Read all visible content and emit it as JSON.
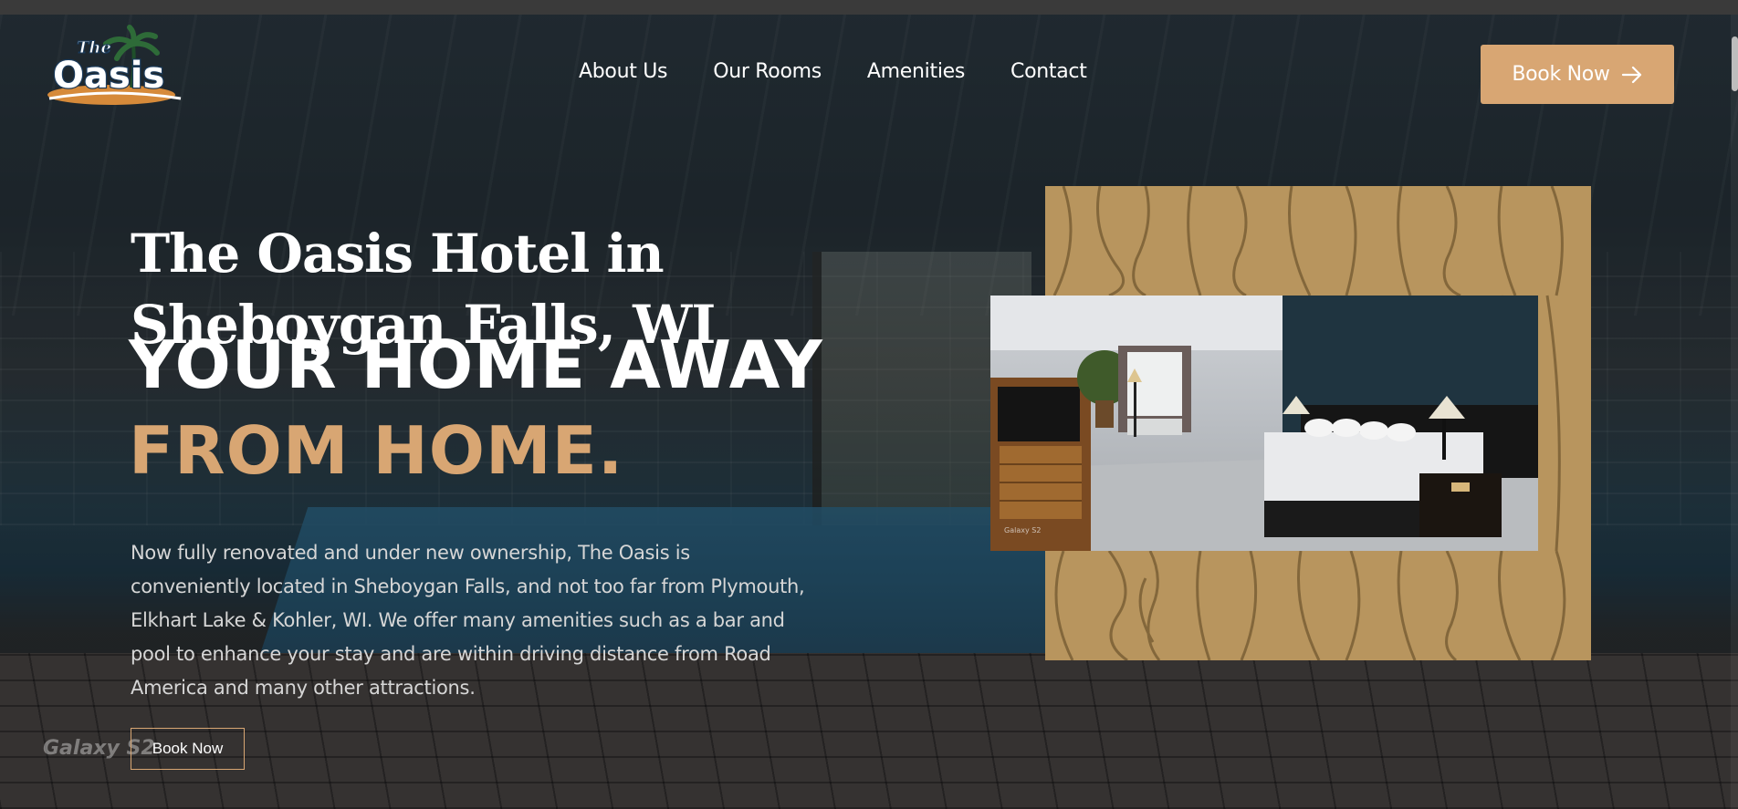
{
  "header": {
    "logo_text_top": "The",
    "logo_text_main": "Oasis",
    "nav": [
      {
        "label": "About Us"
      },
      {
        "label": "Our Rooms"
      },
      {
        "label": "Amenities"
      },
      {
        "label": "Contact"
      }
    ],
    "book_now_label": "Book Now",
    "book_now_icon": "arrow-right-icon"
  },
  "hero": {
    "title": "The Oasis Hotel in Sheboygan Falls, WI",
    "tagline_line1": "YOUR HOME AWAY",
    "tagline_line2": "FROM HOME.",
    "description": "Now fully renovated and under new ownership, The Oasis is conveniently located in Sheboygan Falls, and not too far from Plymouth, Elkhart Lake & Kohler, WI. We offer many amenities such as a bar and pool to enhance your stay and are within driving distance from Road America and many other attractions.",
    "book_now_label": "Book Now",
    "photo_watermark": "Galaxy S2"
  },
  "colors": {
    "accent": "#d8a673",
    "wood": "#b8955e",
    "text_primary": "#ffffff",
    "text_secondary": "#d6d6d6"
  }
}
